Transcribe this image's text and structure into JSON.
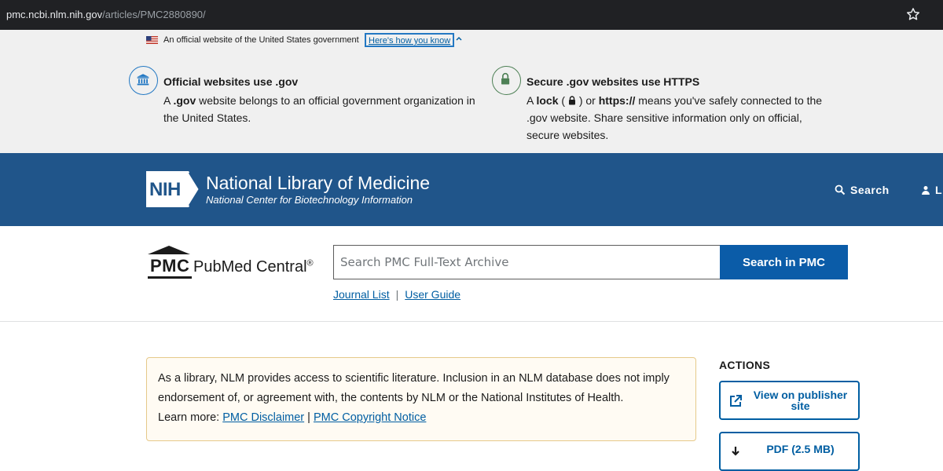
{
  "browser": {
    "url_host": "pmc.ncbi.nlm.nih.gov",
    "url_path": "/articles/PMC2880890/",
    "bookmark_icon": "star-icon"
  },
  "gov_banner": {
    "official_text": "An official website of the United States government",
    "how_you_know": "Here's how you know",
    "flag_icon": "us-flag-icon",
    "box1": {
      "icon": "government-building-icon",
      "title": "Official websites use .gov",
      "desc_prefix": "A ",
      "desc_bold": ".gov",
      "desc_suffix": " website belongs to an official government organization in the United States."
    },
    "box2": {
      "icon": "lock-icon",
      "title": "Secure .gov websites use HTTPS",
      "desc_a": "A ",
      "desc_lock": "lock",
      "desc_b": " ( ",
      "desc_c": " ) or ",
      "desc_https": "https://",
      "desc_d": " means you've safely connected to the .gov website. Share sensitive information only on official, secure websites."
    }
  },
  "nlm_header": {
    "logo_text": "NIH",
    "title": "National Library of Medicine",
    "subtitle": "National Center for Biotechnology Information",
    "search_label": "Search",
    "login_label": "L",
    "bg_color": "#20558a"
  },
  "pmc": {
    "logo_text": "PMC",
    "name": "PubMed Central",
    "reg": "®",
    "search_placeholder": "Search PMC Full-Text Archive",
    "search_button": "Search in PMC",
    "link_journal_list": "Journal List",
    "separator": "|",
    "link_user_guide": "User Guide"
  },
  "disclaimer": {
    "text": "As a library, NLM provides access to scientific literature. Inclusion in an NLM database does not imply endorsement of, or agreement with, the contents by NLM or the National Institutes of Health.",
    "learn_more": "Learn more: ",
    "link1": "PMC Disclaimer",
    "sep": " | ",
    "link2": "PMC Copyright Notice"
  },
  "actions": {
    "header": "ACTIONS",
    "view_publisher": "View on publisher site",
    "pdf": "PDF (2.5 MB)"
  }
}
